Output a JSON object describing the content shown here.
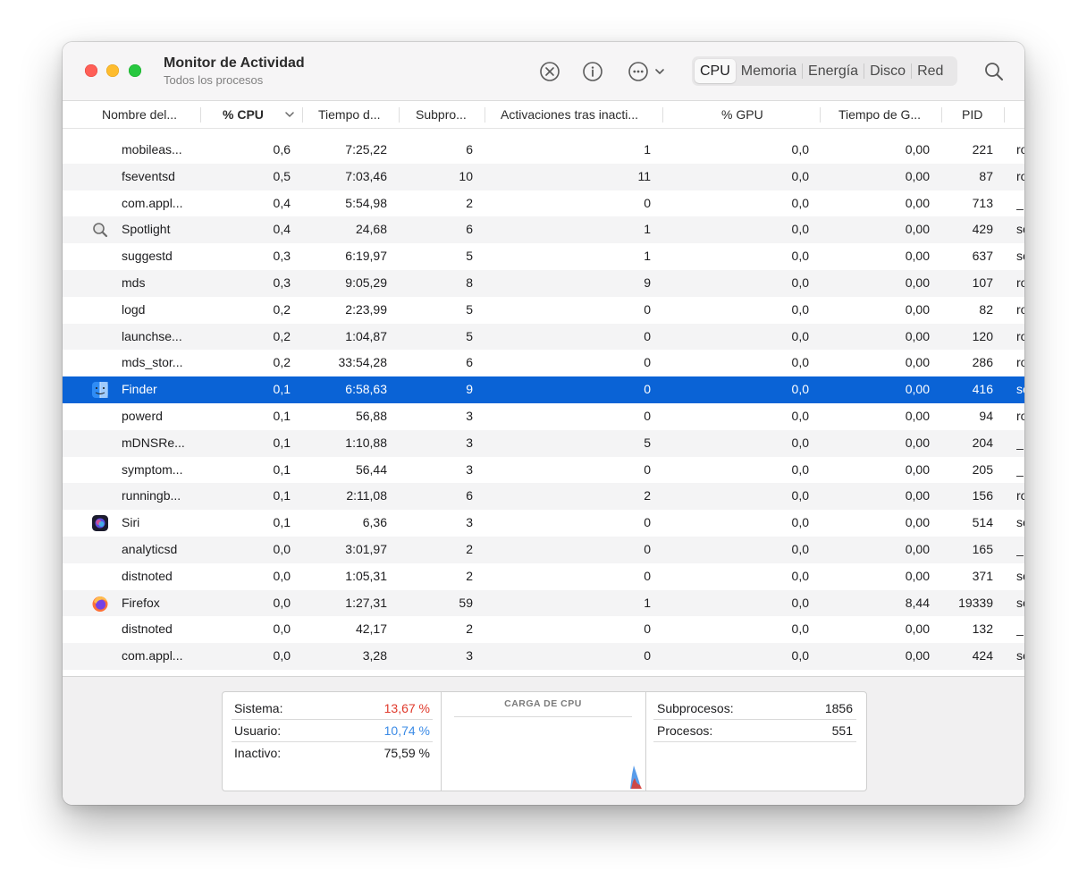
{
  "window": {
    "title": "Monitor de Actividad",
    "subtitle": "Todos los procesos"
  },
  "toolbar": {
    "icons": [
      "stop-icon",
      "info-icon",
      "more-icon"
    ],
    "tabs": [
      "CPU",
      "Memoria",
      "Energía",
      "Disco",
      "Red"
    ],
    "active_tab": "CPU"
  },
  "columns": [
    "Nombre del...",
    "% CPU",
    "Tiempo d...",
    "Subpro...",
    "Activaciones tras inacti...",
    "% GPU",
    "Tiempo de G...",
    "PID"
  ],
  "sorted_column": "% CPU",
  "rows": [
    {
      "name": "mobileas...",
      "cpu": "0,6",
      "time": "7:25,22",
      "threads": "6",
      "wakes": "1",
      "gpu": "0,0",
      "gputime": "0,00",
      "pid": "221",
      "user": "ro",
      "icon": ""
    },
    {
      "name": "fseventsd",
      "cpu": "0,5",
      "time": "7:03,46",
      "threads": "10",
      "wakes": "11",
      "gpu": "0,0",
      "gputime": "0,00",
      "pid": "87",
      "user": "ro",
      "icon": ""
    },
    {
      "name": "com.appl...",
      "cpu": "0,4",
      "time": "5:54,98",
      "threads": "2",
      "wakes": "0",
      "gpu": "0,0",
      "gputime": "0,00",
      "pid": "713",
      "user": "_",
      "icon": ""
    },
    {
      "name": "Spotlight",
      "cpu": "0,4",
      "time": "24,68",
      "threads": "6",
      "wakes": "1",
      "gpu": "0,0",
      "gputime": "0,00",
      "pid": "429",
      "user": "se",
      "icon": "spotlight"
    },
    {
      "name": "suggestd",
      "cpu": "0,3",
      "time": "6:19,97",
      "threads": "5",
      "wakes": "1",
      "gpu": "0,0",
      "gputime": "0,00",
      "pid": "637",
      "user": "se",
      "icon": ""
    },
    {
      "name": "mds",
      "cpu": "0,3",
      "time": "9:05,29",
      "threads": "8",
      "wakes": "9",
      "gpu": "0,0",
      "gputime": "0,00",
      "pid": "107",
      "user": "ro",
      "icon": ""
    },
    {
      "name": "logd",
      "cpu": "0,2",
      "time": "2:23,99",
      "threads": "5",
      "wakes": "0",
      "gpu": "0,0",
      "gputime": "0,00",
      "pid": "82",
      "user": "ro",
      "icon": ""
    },
    {
      "name": "launchse...",
      "cpu": "0,2",
      "time": "1:04,87",
      "threads": "5",
      "wakes": "0",
      "gpu": "0,0",
      "gputime": "0,00",
      "pid": "120",
      "user": "ro",
      "icon": ""
    },
    {
      "name": "mds_stor...",
      "cpu": "0,2",
      "time": "33:54,28",
      "threads": "6",
      "wakes": "0",
      "gpu": "0,0",
      "gputime": "0,00",
      "pid": "286",
      "user": "ro",
      "icon": ""
    },
    {
      "name": "Finder",
      "cpu": "0,1",
      "time": "6:58,63",
      "threads": "9",
      "wakes": "0",
      "gpu": "0,0",
      "gputime": "0,00",
      "pid": "416",
      "user": "se",
      "icon": "finder",
      "selected": true
    },
    {
      "name": "powerd",
      "cpu": "0,1",
      "time": "56,88",
      "threads": "3",
      "wakes": "0",
      "gpu": "0,0",
      "gputime": "0,00",
      "pid": "94",
      "user": "ro",
      "icon": ""
    },
    {
      "name": "mDNSRe...",
      "cpu": "0,1",
      "time": "1:10,88",
      "threads": "3",
      "wakes": "5",
      "gpu": "0,0",
      "gputime": "0,00",
      "pid": "204",
      "user": "_",
      "icon": ""
    },
    {
      "name": "symptom...",
      "cpu": "0,1",
      "time": "56,44",
      "threads": "3",
      "wakes": "0",
      "gpu": "0,0",
      "gputime": "0,00",
      "pid": "205",
      "user": "_",
      "icon": ""
    },
    {
      "name": "runningb...",
      "cpu": "0,1",
      "time": "2:11,08",
      "threads": "6",
      "wakes": "2",
      "gpu": "0,0",
      "gputime": "0,00",
      "pid": "156",
      "user": "ro",
      "icon": ""
    },
    {
      "name": "Siri",
      "cpu": "0,1",
      "time": "6,36",
      "threads": "3",
      "wakes": "0",
      "gpu": "0,0",
      "gputime": "0,00",
      "pid": "514",
      "user": "se",
      "icon": "siri"
    },
    {
      "name": "analyticsd",
      "cpu": "0,0",
      "time": "3:01,97",
      "threads": "2",
      "wakes": "0",
      "gpu": "0,0",
      "gputime": "0,00",
      "pid": "165",
      "user": "_",
      "icon": ""
    },
    {
      "name": "distnoted",
      "cpu": "0,0",
      "time": "1:05,31",
      "threads": "2",
      "wakes": "0",
      "gpu": "0,0",
      "gputime": "0,00",
      "pid": "371",
      "user": "se",
      "icon": ""
    },
    {
      "name": "Firefox",
      "cpu": "0,0",
      "time": "1:27,31",
      "threads": "59",
      "wakes": "1",
      "gpu": "0,0",
      "gputime": "8,44",
      "pid": "19339",
      "user": "se",
      "icon": "firefox"
    },
    {
      "name": "distnoted",
      "cpu": "0,0",
      "time": "42,17",
      "threads": "2",
      "wakes": "0",
      "gpu": "0,0",
      "gputime": "0,00",
      "pid": "132",
      "user": "_",
      "icon": ""
    },
    {
      "name": "com.appl...",
      "cpu": "0,0",
      "time": "3,28",
      "threads": "3",
      "wakes": "0",
      "gpu": "0,0",
      "gputime": "0,00",
      "pid": "424",
      "user": "se",
      "icon": ""
    }
  ],
  "stats": {
    "sistema_label": "Sistema:",
    "sistema_value": "13,67 %",
    "usuario_label": "Usuario:",
    "usuario_value": "10,74 %",
    "inactivo_label": "Inactivo:",
    "inactivo_value": "75,59 %",
    "chart_title": "CARGA DE CPU",
    "subprocesos_label": "Subprocesos:",
    "subprocesos_value": "1856",
    "procesos_label": "Procesos:",
    "procesos_value": "551"
  },
  "colors": {
    "selection": "#0a63d6",
    "system": "#e0392b",
    "user": "#3b8be6"
  }
}
